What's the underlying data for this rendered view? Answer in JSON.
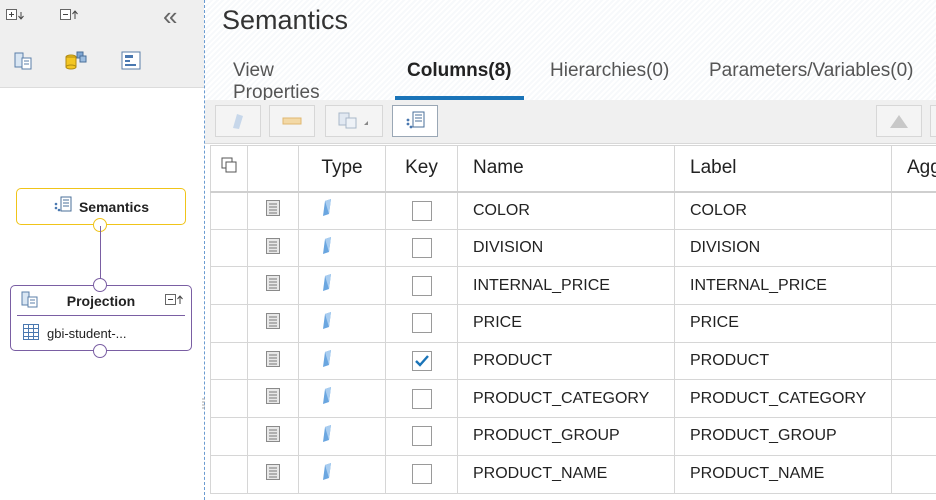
{
  "diagram": {
    "semantics_node": {
      "label": "Semantics"
    },
    "projection_node": {
      "label": "Projection",
      "source": "gbi-student-..."
    },
    "collapse_label": "«"
  },
  "header": {
    "title": "Semantics",
    "tabs": [
      {
        "label": "View Properties",
        "active": false
      },
      {
        "label": "Columns(8)",
        "active": true
      },
      {
        "label": "Hierarchies(0)",
        "active": false
      },
      {
        "label": "Parameters/Variables(0)",
        "active": false
      }
    ]
  },
  "table": {
    "headers": {
      "type": "Type",
      "key": "Key",
      "name": "Name",
      "label": "Label",
      "agg": "Agg"
    },
    "rows": [
      {
        "key": false,
        "name": "COLOR",
        "label": "COLOR"
      },
      {
        "key": false,
        "name": "DIVISION",
        "label": "DIVISION"
      },
      {
        "key": false,
        "name": "INTERNAL_PRICE",
        "label": "INTERNAL_PRICE"
      },
      {
        "key": false,
        "name": "PRICE",
        "label": "PRICE"
      },
      {
        "key": true,
        "name": "PRODUCT",
        "label": "PRODUCT"
      },
      {
        "key": false,
        "name": "PRODUCT_CATEGORY",
        "label": "PRODUCT_CATEGORY"
      },
      {
        "key": false,
        "name": "PRODUCT_GROUP",
        "label": "PRODUCT_GROUP"
      },
      {
        "key": false,
        "name": "PRODUCT_NAME",
        "label": "PRODUCT_NAME"
      }
    ]
  },
  "colors": {
    "accent": "#1a74b8",
    "semantics_border": "#f0c419",
    "projection_border": "#7a5ea3",
    "check": "#1a74b8"
  }
}
